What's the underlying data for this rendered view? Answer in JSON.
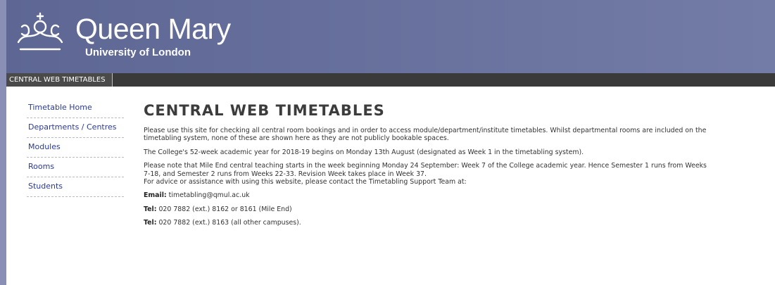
{
  "logo": {
    "name": "Queen Mary",
    "subtitle": "University of London"
  },
  "site_tab": "CENTRAL WEB TIMETABLES",
  "nav": [
    "Timetable Home",
    "Departments / Centres",
    "Modules",
    "Rooms",
    "Students"
  ],
  "main": {
    "title": "CENTRAL WEB TIMETABLES",
    "para1_line1": "Please use this site for checking all central room bookings and in order to access module/department/institute timetables. Whilst departmental rooms are included on the",
    "para1_line2": "timetabling system, none of these are shown here as they are not publicly bookable spaces.",
    "para2": "The College's 52-week academic year for 2018-19 begins on Monday 13th August (designated as Week 1 in the timetabling system).",
    "para3_line1": "Please note that Mile End central teaching starts in the week beginning Monday 24 September: Week 7 of the College academic year. Hence Semester 1 runs from Weeks",
    "para3_line2": "7-18, and Semester 2 runs from Weeks 22-33. Revision Week takes place in Week 37.",
    "para3_line3": "For advice or assistance with using this website, please contact the Timetabling Support Team at:",
    "email_label": "Email:",
    "email_value": "timetabling@qmul.ac.uk",
    "tel1_label": "Tel:",
    "tel1_value": "020 7882 (ext.) 8162 or 8161 (Mile End)",
    "tel2_label": "Tel:",
    "tel2_value": "020 7882 (ext.) 8163 (all other campuses)."
  },
  "colors": {
    "header": "#67709c",
    "site_bar": "#3a3a3a",
    "link": "#2b3a8f",
    "left_bar": "#8a8fb6"
  }
}
